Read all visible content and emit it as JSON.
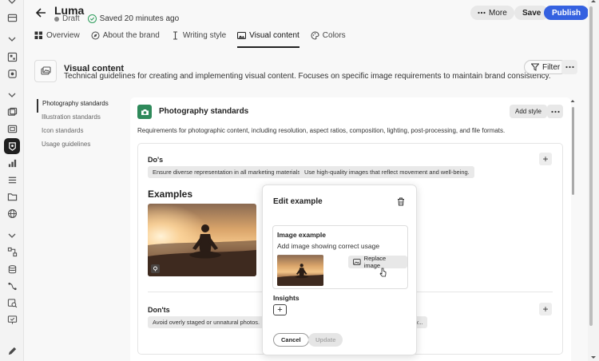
{
  "app": {
    "title": "Luma",
    "status": "Draft",
    "saved": "Saved 20 minutes ago",
    "actions": {
      "more": "More",
      "save": "Save",
      "publish": "Publish"
    }
  },
  "tabs": [
    {
      "label": "Overview",
      "icon": "grid-icon"
    },
    {
      "label": "About the brand",
      "icon": "compass-icon"
    },
    {
      "label": "Writing style",
      "icon": "text-cursor-icon"
    },
    {
      "label": "Visual content",
      "icon": "image-icon",
      "active": true
    },
    {
      "label": "Colors",
      "icon": "palette-icon"
    }
  ],
  "section": {
    "title": "Visual content",
    "description": "Technical guidelines for creating and implementing visual content. Focuses on specific image requirements to maintain brand consistency.",
    "filter": "Filter"
  },
  "sidenav": {
    "items": [
      "Photography standards",
      "Illustration standards",
      "Icon standards",
      "Usage guidelines"
    ]
  },
  "card": {
    "title": "Photography standards",
    "add_style": "Add style",
    "description": "Requirements for photographic content, including resolution, aspect ratios, composition, lighting, post-processing, and file formats.",
    "dos_label": "Do's",
    "dos": [
      "Ensure diverse representation in all marketing materials.",
      "Use high-quality images that reflect movement and well-being."
    ],
    "examples_label": "Examples",
    "donts_label": "Don'ts",
    "donts": [
      "Avoid overly staged or unnatural photos.",
      "...",
      "y..."
    ]
  },
  "dialog": {
    "title": "Edit example",
    "image_title": "Image example",
    "image_sub": "Add image showing correct usage",
    "replace": "Replace image",
    "insights_label": "Insights",
    "insights_add": "+",
    "cancel": "Cancel",
    "update": "Update"
  },
  "colors": {
    "accent": "#3561e0",
    "brand_green": "#2f8a5b",
    "saved_check": "#2d9d5c"
  }
}
